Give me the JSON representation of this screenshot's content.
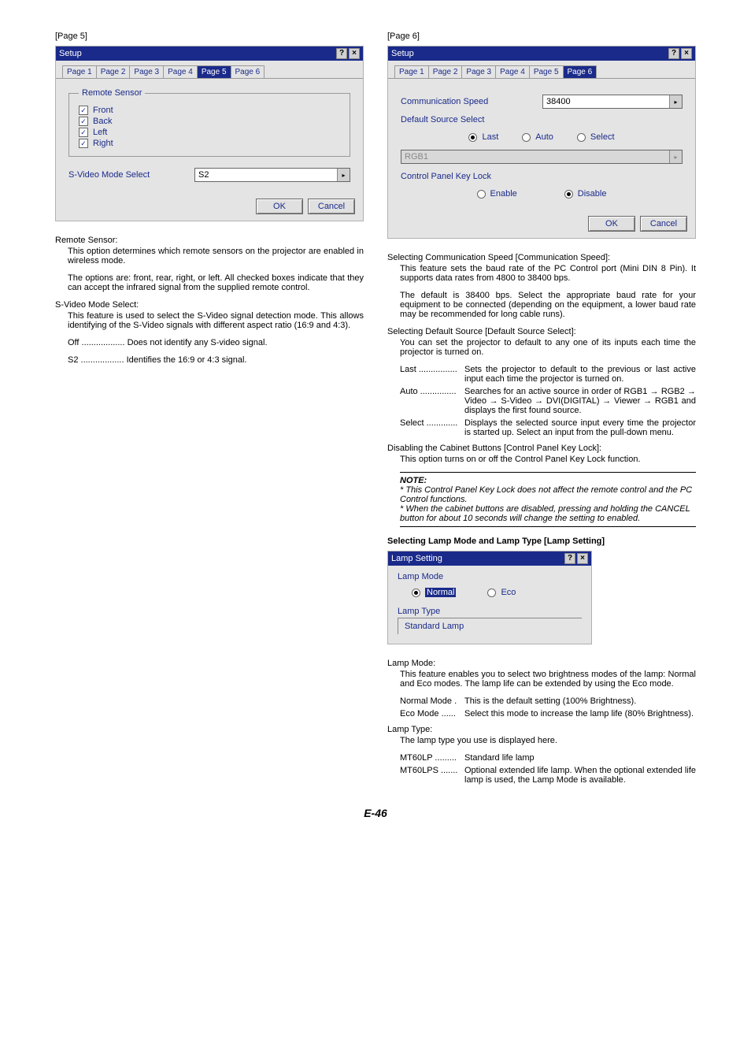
{
  "pageLabels": {
    "p5": "[Page 5]",
    "p6": "[Page 6]"
  },
  "setup5": {
    "title": "Setup",
    "tabs": [
      "Page 1",
      "Page 2",
      "Page 3",
      "Page 4",
      "Page 5",
      "Page 6"
    ],
    "selectedTab": 4,
    "fieldsetLegend": "Remote Sensor",
    "checks": {
      "front": "Front",
      "back": "Back",
      "left": "Left",
      "right": "Right"
    },
    "svideoLabel": "S-Video Mode Select",
    "svideoValue": "S2",
    "ok": "OK",
    "cancel": "Cancel"
  },
  "setup6": {
    "title": "Setup",
    "tabs": [
      "Page 1",
      "Page 2",
      "Page 3",
      "Page 4",
      "Page 5",
      "Page 6"
    ],
    "selectedTab": 5,
    "commSpeedLabel": "Communication Speed",
    "commSpeedValue": "38400",
    "defSrcLabel": "Default Source Select",
    "radios": {
      "last": "Last",
      "auto": "Auto",
      "select": "Select"
    },
    "srcValue": "RGB1",
    "panelLockLabel": "Control Panel Key Lock",
    "enable": "Enable",
    "disable": "Disable",
    "ok": "OK",
    "cancel": "Cancel"
  },
  "lampDialog": {
    "title": "Lamp Setting",
    "lampModeLabel": "Lamp Mode",
    "normal": "Normal",
    "eco": "Eco",
    "lampTypeLabel": "Lamp Type",
    "lampTypeValue": "Standard Lamp"
  },
  "textLeft": {
    "h1": "Remote Sensor:",
    "p1": "This option determines which remote sensors on the projector are enabled in wireless mode.",
    "p2": "The options are: front, rear, right, or left. All checked boxes indicate that they can accept the infrared signal from the supplied remote control.",
    "h2": "S-Video Mode Select:",
    "p3": "This feature is used to select the S-Video signal detection mode. This allows identifying of the S-Video signals with different aspect ratio (16:9 and 4:3).",
    "off": "Off .................. Does not identify any S-video signal.",
    "s2": "S2 .................. Identifies the 16:9 or 4:3 signal."
  },
  "textRight": {
    "h1": "Selecting Communication Speed [Communication Speed]:",
    "p1": "This feature sets the baud rate of the PC Control port (Mini DIN 8 Pin). It supports data rates from 4800 to 38400 bps.",
    "p2": "The default is 38400 bps. Select the appropriate baud rate for your equipment to be connected (depending on the equipment, a lower baud rate may be recommended for long cable runs).",
    "h2": "Selecting Default Source [Default Source Select]:",
    "p3": "You can set the projector to default to any one of its inputs each time the projector is turned on.",
    "lastTerm": "Last ................",
    "lastDesc": "Sets the projector to default to the previous or last active input each time the projector is turned on.",
    "autoTerm": "Auto ...............",
    "autoDesc": "Searches for an active source in order of RGB1 → RGB2 → Video → S-Video → DVI(DIGITAL) → Viewer → RGB1 and displays the first found source.",
    "selectTerm": "Select .............",
    "selectDesc": "Displays the selected source input every time the projector is started up. Select an input from the pull-down menu.",
    "h3": "Disabling the Cabinet Buttons [Control Panel Key Lock]:",
    "p4": "This option turns on or off the Control Panel Key Lock function.",
    "noteTitle": "NOTE:",
    "note1": "* This Control Panel Key Lock does not affect the remote control and the PC Control functions.",
    "note2": "* When the cabinet buttons are disabled, pressing and holding the CANCEL button for about 10 seconds will change the setting to enabled.",
    "h4": "Selecting Lamp Mode and Lamp Type [Lamp Setting]",
    "h5": "Lamp Mode:",
    "p5": "This feature enables you to select two brightness modes of the lamp: Normal and Eco modes. The lamp life can be extended by using the Eco mode.",
    "normalTerm": "Normal Mode .",
    "normalDesc": "This is the default setting (100% Brightness).",
    "ecoTerm": "Eco Mode ......",
    "ecoDesc": "Select this mode to increase the lamp life (80% Brightness).",
    "h6": "Lamp Type:",
    "p6": "The lamp type you use is displayed here.",
    "mt60lpTerm": "MT60LP .........",
    "mt60lpDesc": "Standard life lamp",
    "mt60lpsTerm": "MT60LPS .......",
    "mt60lpsDesc": "Optional extended life lamp. When the optional extended life lamp is used, the Lamp Mode is available."
  },
  "pageNumber": "E-46"
}
